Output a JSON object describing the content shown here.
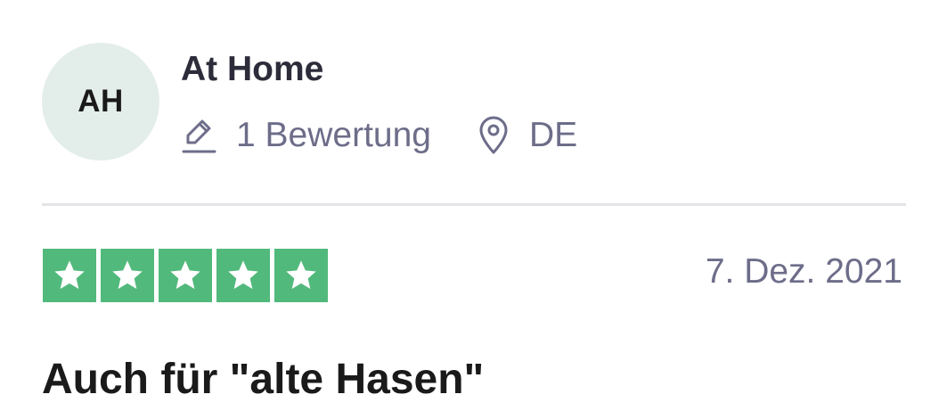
{
  "reviewer": {
    "initials": "AH",
    "name": "At Home",
    "review_count": "1 Bewertung",
    "country": "DE",
    "avatar_bg": "#e3eeeb"
  },
  "meta_icons": {
    "review_count_icon": "pencil-icon",
    "country_icon": "location-pin-icon"
  },
  "review": {
    "rating": 5,
    "rating_max": 5,
    "star_color": "#52b97c",
    "date": "7. Dez. 2021",
    "title": "Auch für \"alte Hasen\""
  }
}
